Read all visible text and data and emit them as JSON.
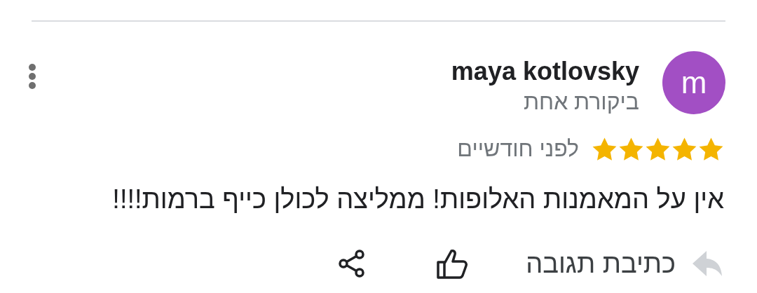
{
  "review": {
    "avatar_letter": "m",
    "author": "maya kotlovsky",
    "author_meta": "ביקורת אחת",
    "stars": 5,
    "time": "לפני חודשיים",
    "text": "אין על המאמנות האלופות! ממליצה לכולן כייף ברמות!!!!"
  },
  "actions": [
    {
      "kind": "reply",
      "label": "כתיבת תגובה"
    },
    {
      "kind": "like"
    },
    {
      "kind": "share"
    }
  ]
}
